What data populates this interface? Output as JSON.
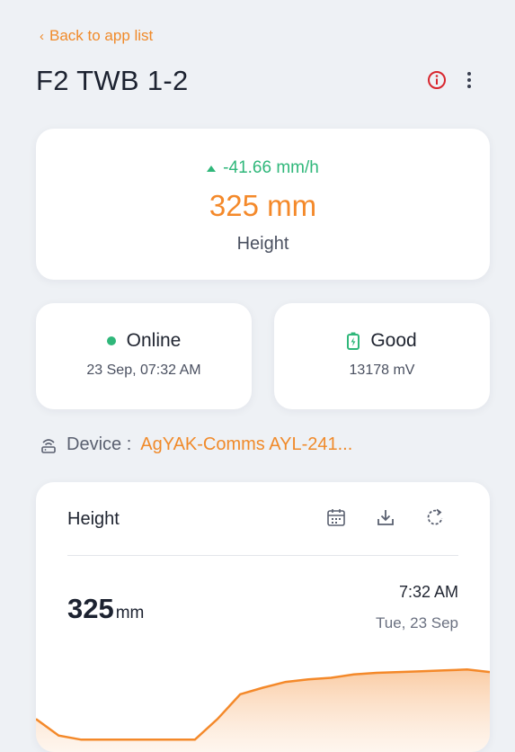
{
  "header": {
    "back_label": "Back to app list",
    "title": "F2 TWB 1-2",
    "info_icon": "info-circle-icon",
    "menu_icon": "kebab-menu-icon"
  },
  "summary": {
    "rate": "-41.66 mm/h",
    "rate_direction": "up",
    "value": "325 mm",
    "label": "Height",
    "rate_color": "#2fb77a",
    "value_color": "#f4892a"
  },
  "status": {
    "online": {
      "label": "Online",
      "timestamp": "23 Sep, 07:32 AM",
      "icon": "status-dot-icon"
    },
    "battery": {
      "label": "Good",
      "voltage": "13178 mV",
      "icon": "battery-icon"
    }
  },
  "device": {
    "label": "Device :",
    "name": "AgYAK-Comms AYL-241...",
    "icon": "router-icon"
  },
  "chart_card": {
    "title": "Height",
    "tools": [
      "calendar-icon",
      "download-icon",
      "refresh-icon"
    ],
    "current_value": "325",
    "current_unit": "mm",
    "current_time": "7:32 AM",
    "current_date": "Tue, 23 Sep"
  },
  "chart_data": {
    "type": "area",
    "title": "",
    "xlabel": "",
    "ylabel": "",
    "x": [
      0,
      1,
      2,
      3,
      4,
      5,
      6,
      7,
      8,
      9,
      10,
      11,
      12,
      13,
      14,
      15,
      16,
      17,
      18,
      19,
      20
    ],
    "series": [
      {
        "values": [
          40,
          20,
          15,
          15,
          15,
          15,
          15,
          15,
          40,
          70,
          78,
          85,
          88,
          90,
          94,
          96,
          97,
          98,
          99,
          100,
          97
        ]
      }
    ],
    "ylim": [
      0,
      120
    ],
    "color": "#f4892a",
    "grid": false,
    "axes_visible": false
  }
}
